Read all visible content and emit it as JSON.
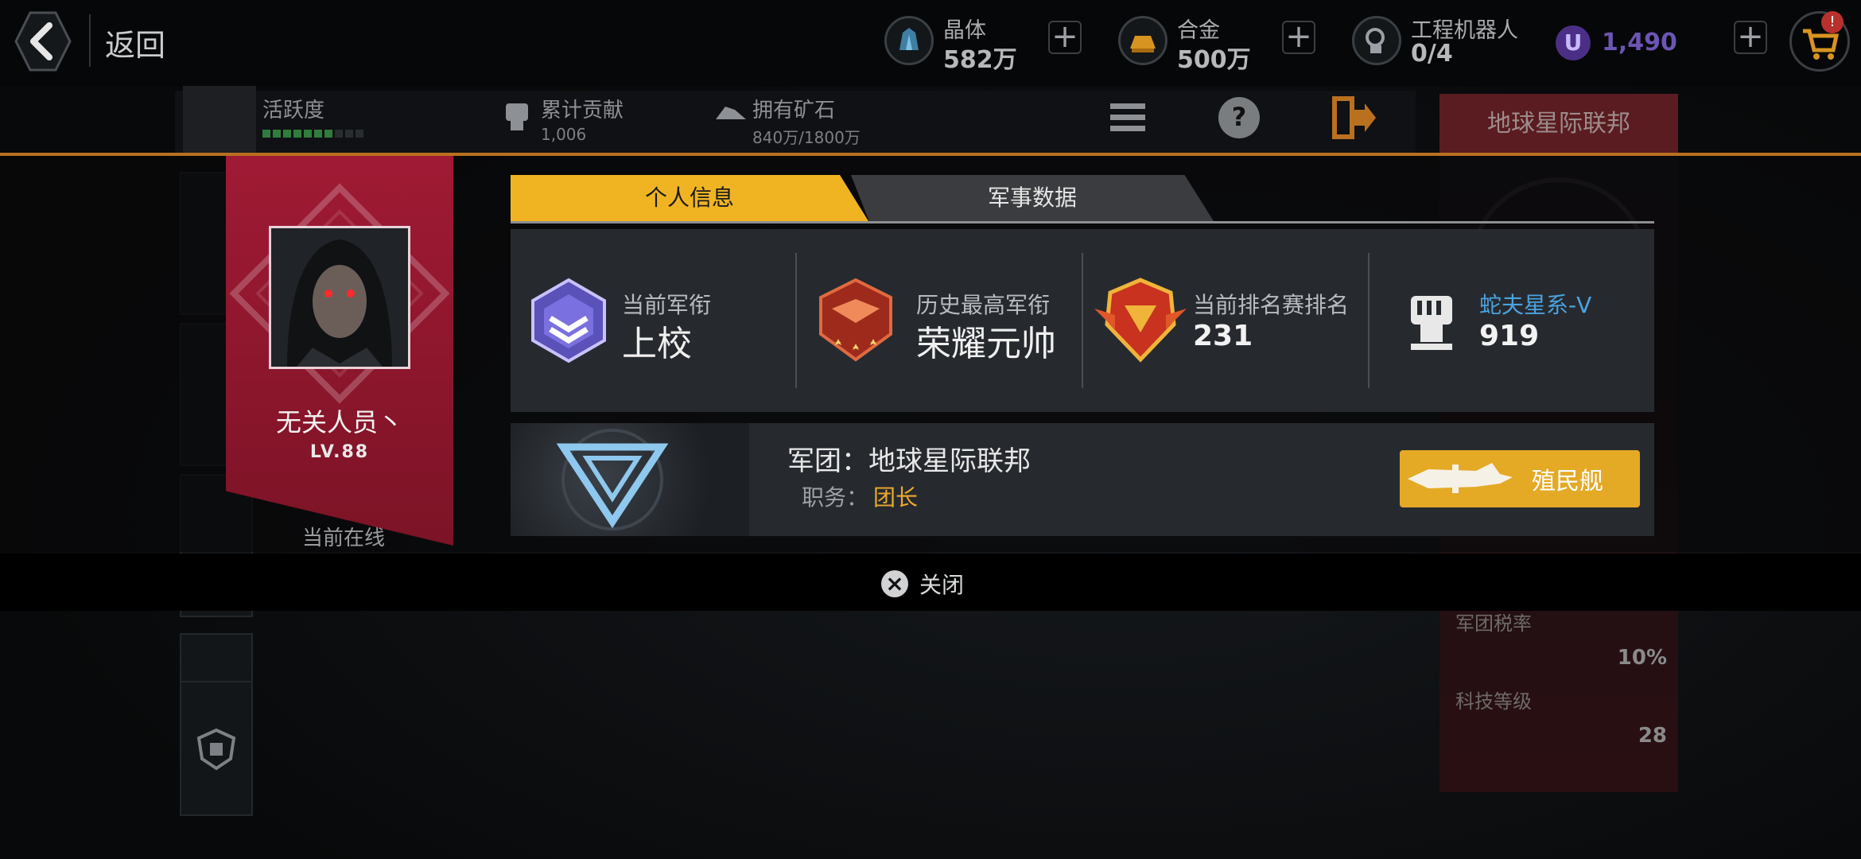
{
  "header": {
    "back_label": "返回",
    "resources": [
      {
        "name": "晶体",
        "value": "582万",
        "icon": "crystal-icon"
      },
      {
        "name": "合金",
        "value": "500万",
        "icon": "alloy-icon"
      },
      {
        "name": "工程机器人",
        "value": "0/4",
        "icon": "robot-icon"
      }
    ],
    "currency_symbol": "U",
    "currency_value": "1,490",
    "cart_badge": "!"
  },
  "subbar": {
    "activity_label": "活跃度",
    "activity_level": 0.6,
    "contribution_label": "累计贡献",
    "contribution_value": "1,006",
    "ore_label": "拥有矿石",
    "ore_value": "840万/1800万",
    "union_tab": "地球星际联邦"
  },
  "right_panel": {
    "tax_label": "军团税率",
    "tax_value": "10%",
    "tech_label": "科技等级",
    "tech_value": "28"
  },
  "profile": {
    "name": "无关人员丶",
    "level": "LV.88",
    "status": "当前在线"
  },
  "tabs": {
    "personal": "个人信息",
    "military": "军事数据"
  },
  "stats": {
    "current_rank_label": "当前军衔",
    "current_rank": "上校",
    "highest_rank_label": "历史最高军衔",
    "highest_rank": "荣耀元帅",
    "arena_rank_label": "当前排名赛排名",
    "arena_rank": "231",
    "galaxy_label": "蛇夫星系-V",
    "galaxy_value": "919"
  },
  "union": {
    "name_text": "军团：地球星际联邦",
    "role_label": "职务：",
    "role": "团长",
    "colony_button": "殖民舰"
  },
  "footer": {
    "close_label": "关闭"
  },
  "colors": {
    "accent_gold": "#f0b423",
    "banner_red": "#a01a34",
    "galaxy_blue": "#4aa3e0",
    "role_orange": "#eea92a"
  }
}
